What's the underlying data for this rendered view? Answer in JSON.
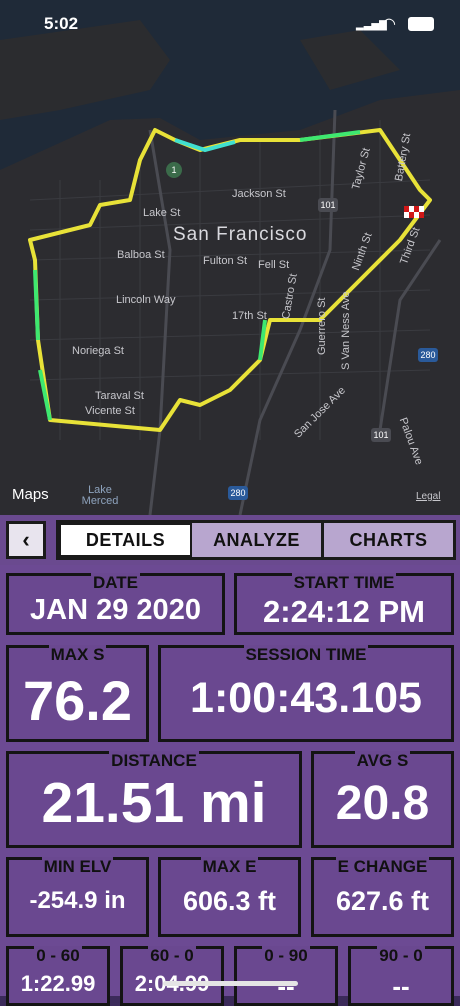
{
  "status": {
    "time": "5:02"
  },
  "map": {
    "city": "San Francisco",
    "streets": [
      {
        "id": "jackson",
        "label": "Jackson St"
      },
      {
        "id": "lake",
        "label": "Lake St"
      },
      {
        "id": "fulton",
        "label": "Fulton St"
      },
      {
        "id": "fell",
        "label": "Fell St"
      },
      {
        "id": "balboa",
        "label": "Balboa St"
      },
      {
        "id": "lincoln",
        "label": "Lincoln Way"
      },
      {
        "id": "17th",
        "label": "17th St"
      },
      {
        "id": "castro",
        "label": "Castro St"
      },
      {
        "id": "guerrero",
        "label": "Guerrero St"
      },
      {
        "id": "svanness",
        "label": "S Van Ness Ave"
      },
      {
        "id": "noriega",
        "label": "Noriega St"
      },
      {
        "id": "taraval",
        "label": "Taraval St"
      },
      {
        "id": "vicente",
        "label": "Vicente St"
      },
      {
        "id": "sanjose",
        "label": "San Jose Ave"
      },
      {
        "id": "taylor",
        "label": "Taylor St"
      },
      {
        "id": "battery",
        "label": "Battery St"
      },
      {
        "id": "third",
        "label": "Third St"
      },
      {
        "id": "ninth",
        "label": "Ninth St"
      },
      {
        "id": "palou",
        "label": "Palou Ave"
      },
      {
        "id": "lakemerced",
        "label": "Lake Merced"
      }
    ],
    "highway_shields": [
      "1",
      "101",
      "280",
      "101",
      "280"
    ],
    "brand": "Maps",
    "legal": "Legal"
  },
  "nav": {
    "back_icon": "chevron-left-icon",
    "tabs": [
      "DETAILS",
      "ANALYZE",
      "CHARTS"
    ],
    "active_tab": "DETAILS"
  },
  "stats": {
    "date": {
      "label": "DATE",
      "value": "JAN 29 2020"
    },
    "start_time": {
      "label": "START TIME",
      "value": "2:24:12 PM"
    },
    "max_s": {
      "label": "MAX S",
      "value": "76.2"
    },
    "session_time": {
      "label": "SESSION TIME",
      "value": "1:00:43.105"
    },
    "distance": {
      "label": "DISTANCE",
      "value": "21.51 mi"
    },
    "avg_s": {
      "label": "AVG S",
      "value": "20.8"
    },
    "min_elv": {
      "label": "MIN ELV",
      "value": "-254.9 in"
    },
    "max_e": {
      "label": "MAX E",
      "value": "606.3 ft"
    },
    "e_change": {
      "label": "E CHANGE",
      "value": "627.6 ft"
    },
    "zero_60": {
      "label": "0 - 60",
      "value": "1:22.99"
    },
    "sixty_0": {
      "label": "60 - 0",
      "value": "2:04.99"
    },
    "zero_90": {
      "label": "0 - 90",
      "value": "--"
    },
    "ninety_0": {
      "label": "90 - 0",
      "value": "--"
    }
  },
  "colors": {
    "accent": "#6c4a93",
    "tab_inactive": "#b8a6cf",
    "route_fast": "#36e86a",
    "route_slow": "#f0e030"
  }
}
